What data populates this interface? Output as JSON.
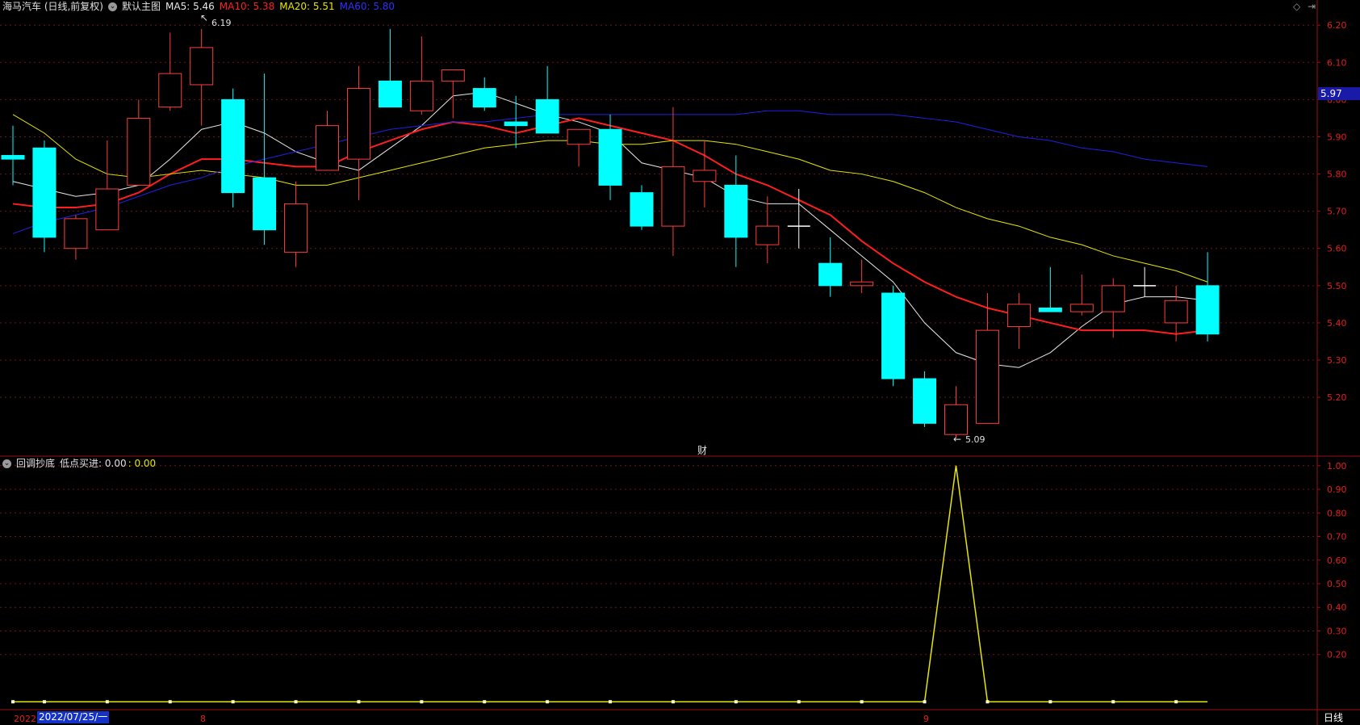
{
  "header": {
    "title": "海马汽车 (日线,前复权)",
    "main_chart_label": "默认主图",
    "ma5_label": "MA5: 5.46",
    "ma10_label": "MA10: 5.38",
    "ma20_label": "MA20: 5.51",
    "ma60_label": "MA60: 5.80"
  },
  "sub_header": {
    "indicator_name": "回调抄底",
    "indicator_value": "低点买进: 0.00",
    "indicator_value2": ": 0.00"
  },
  "colors": {
    "up": "#ff3c3c",
    "down": "#00ffff",
    "ma5": "#e8e8e8",
    "ma10": "#ff1e1e",
    "ma20": "#e6e600",
    "ma60": "#2020e8",
    "grid": "#6e1414",
    "axis_text": "#e0201e"
  },
  "annotations": {
    "high_label": "6.19",
    "low_label": "5.09",
    "fin_marker": "财",
    "current_price": "5.97",
    "cursor_date": "2022/07/25/一",
    "year_prefix": "2022",
    "month_label_1": "8",
    "month_label_2": "9",
    "period": "日线"
  },
  "chart_data": [
    {
      "type": "candlestick",
      "title": "海马汽车 (日线,前复权)",
      "y_ticks": [
        6.2,
        6.1,
        6.0,
        5.9,
        5.8,
        5.7,
        5.6,
        5.5,
        5.4,
        5.3,
        5.2
      ],
      "ylim": [
        5.07,
        6.22
      ],
      "candles": [
        {
          "o": 5.85,
          "h": 5.93,
          "l": 5.77,
          "c": 5.84
        },
        {
          "o": 5.87,
          "h": 5.89,
          "l": 5.59,
          "c": 5.63
        },
        {
          "o": 5.6,
          "h": 5.69,
          "l": 5.57,
          "c": 5.68
        },
        {
          "o": 5.65,
          "h": 5.89,
          "l": 5.65,
          "c": 5.76
        },
        {
          "o": 5.77,
          "h": 6.0,
          "l": 5.77,
          "c": 5.95
        },
        {
          "o": 5.98,
          "h": 6.18,
          "l": 5.97,
          "c": 6.07
        },
        {
          "o": 6.04,
          "h": 6.19,
          "l": 5.93,
          "c": 6.14
        },
        {
          "o": 6.0,
          "h": 6.03,
          "l": 5.71,
          "c": 5.75
        },
        {
          "o": 5.79,
          "h": 6.07,
          "l": 5.61,
          "c": 5.65
        },
        {
          "o": 5.59,
          "h": 5.78,
          "l": 5.55,
          "c": 5.72
        },
        {
          "o": 5.81,
          "h": 5.97,
          "l": 5.81,
          "c": 5.93
        },
        {
          "o": 5.84,
          "h": 6.09,
          "l": 5.73,
          "c": 6.03
        },
        {
          "o": 6.05,
          "h": 6.19,
          "l": 5.98,
          "c": 5.98
        },
        {
          "o": 5.97,
          "h": 6.17,
          "l": 5.96,
          "c": 6.05
        },
        {
          "o": 6.05,
          "h": 6.07,
          "l": 5.95,
          "c": 6.08
        },
        {
          "o": 6.03,
          "h": 6.06,
          "l": 5.97,
          "c": 5.98
        },
        {
          "o": 5.94,
          "h": 6.01,
          "l": 5.87,
          "c": 5.93
        },
        {
          "o": 6.0,
          "h": 6.09,
          "l": 5.92,
          "c": 5.91
        },
        {
          "o": 5.88,
          "h": 5.92,
          "l": 5.82,
          "c": 5.92
        },
        {
          "o": 5.92,
          "h": 5.96,
          "l": 5.73,
          "c": 5.77
        },
        {
          "o": 5.75,
          "h": 5.77,
          "l": 5.65,
          "c": 5.66
        },
        {
          "o": 5.66,
          "h": 5.98,
          "l": 5.58,
          "c": 5.82
        },
        {
          "o": 5.78,
          "h": 5.89,
          "l": 5.71,
          "c": 5.81
        },
        {
          "o": 5.77,
          "h": 5.85,
          "l": 5.55,
          "c": 5.63
        },
        {
          "o": 5.61,
          "h": 5.74,
          "l": 5.56,
          "c": 5.66
        },
        {
          "o": 5.66,
          "h": 5.76,
          "l": 5.6,
          "c": 5.66
        },
        {
          "o": 5.56,
          "h": 5.63,
          "l": 5.47,
          "c": 5.5
        },
        {
          "o": 5.5,
          "h": 5.57,
          "l": 5.48,
          "c": 5.51
        },
        {
          "o": 5.48,
          "h": 5.5,
          "l": 5.23,
          "c": 5.25
        },
        {
          "o": 5.25,
          "h": 5.27,
          "l": 5.12,
          "c": 5.13
        },
        {
          "o": 5.1,
          "h": 5.23,
          "l": 5.09,
          "c": 5.18
        },
        {
          "o": 5.13,
          "h": 5.48,
          "l": 5.13,
          "c": 5.38
        },
        {
          "o": 5.39,
          "h": 5.48,
          "l": 5.33,
          "c": 5.45
        },
        {
          "o": 5.44,
          "h": 5.55,
          "l": 5.43,
          "c": 5.43
        },
        {
          "o": 5.43,
          "h": 5.53,
          "l": 5.42,
          "c": 5.45
        },
        {
          "o": 5.43,
          "h": 5.52,
          "l": 5.36,
          "c": 5.5
        },
        {
          "o": 5.5,
          "h": 5.55,
          "l": 5.47,
          "c": 5.5
        },
        {
          "o": 5.4,
          "h": 5.5,
          "l": 5.35,
          "c": 5.46
        },
        {
          "o": 5.5,
          "h": 5.59,
          "l": 5.35,
          "c": 5.37
        }
      ],
      "series": [
        {
          "name": "MA5",
          "values": [
            5.78,
            5.76,
            5.74,
            5.75,
            5.77,
            5.84,
            5.92,
            5.94,
            5.91,
            5.86,
            5.83,
            5.81,
            5.87,
            5.93,
            6.01,
            6.02,
            5.99,
            5.96,
            5.94,
            5.91,
            5.83,
            5.81,
            5.79,
            5.74,
            5.72,
            5.72,
            5.65,
            5.58,
            5.51,
            5.4,
            5.32,
            5.29,
            5.28,
            5.32,
            5.39,
            5.45,
            5.47,
            5.47,
            5.46
          ]
        },
        {
          "name": "MA10",
          "values": [
            5.72,
            5.71,
            5.71,
            5.72,
            5.75,
            5.8,
            5.84,
            5.84,
            5.83,
            5.82,
            5.82,
            5.86,
            5.89,
            5.92,
            5.94,
            5.93,
            5.91,
            5.93,
            5.95,
            5.93,
            5.91,
            5.89,
            5.85,
            5.8,
            5.77,
            5.73,
            5.69,
            5.62,
            5.56,
            5.51,
            5.47,
            5.44,
            5.42,
            5.4,
            5.38,
            5.38,
            5.38,
            5.37,
            5.38
          ]
        },
        {
          "name": "MA20",
          "values": [
            5.96,
            5.91,
            5.84,
            5.8,
            5.79,
            5.8,
            5.81,
            5.8,
            5.79,
            5.77,
            5.77,
            5.79,
            5.81,
            5.83,
            5.85,
            5.87,
            5.88,
            5.89,
            5.89,
            5.88,
            5.88,
            5.89,
            5.89,
            5.88,
            5.86,
            5.84,
            5.81,
            5.8,
            5.78,
            5.75,
            5.71,
            5.68,
            5.66,
            5.63,
            5.61,
            5.58,
            5.56,
            5.54,
            5.51
          ]
        },
        {
          "name": "MA60",
          "values": [
            5.64,
            5.67,
            5.69,
            5.71,
            5.74,
            5.77,
            5.79,
            5.82,
            5.84,
            5.86,
            5.88,
            5.9,
            5.92,
            5.93,
            5.94,
            5.94,
            5.95,
            5.96,
            5.96,
            5.96,
            5.96,
            5.96,
            5.96,
            5.96,
            5.97,
            5.97,
            5.96,
            5.96,
            5.96,
            5.95,
            5.94,
            5.92,
            5.9,
            5.89,
            5.87,
            5.86,
            5.84,
            5.83,
            5.82
          ]
        }
      ]
    },
    {
      "type": "line",
      "title": "回调抄底",
      "y_ticks": [
        1.0,
        0.9,
        0.8,
        0.7,
        0.6,
        0.5,
        0.4,
        0.3,
        0.2
      ],
      "ylim": [
        -0.03,
        1.03
      ],
      "series": [
        {
          "name": "低点买进",
          "values": [
            0,
            0,
            0,
            0,
            0,
            0,
            0,
            0,
            0,
            0,
            0,
            0,
            0,
            0,
            0,
            0,
            0,
            0,
            0,
            0,
            0,
            0,
            0,
            0,
            0,
            0,
            0,
            0,
            0,
            0,
            1,
            0,
            0,
            0,
            0,
            0,
            0,
            0,
            0
          ]
        }
      ]
    }
  ]
}
